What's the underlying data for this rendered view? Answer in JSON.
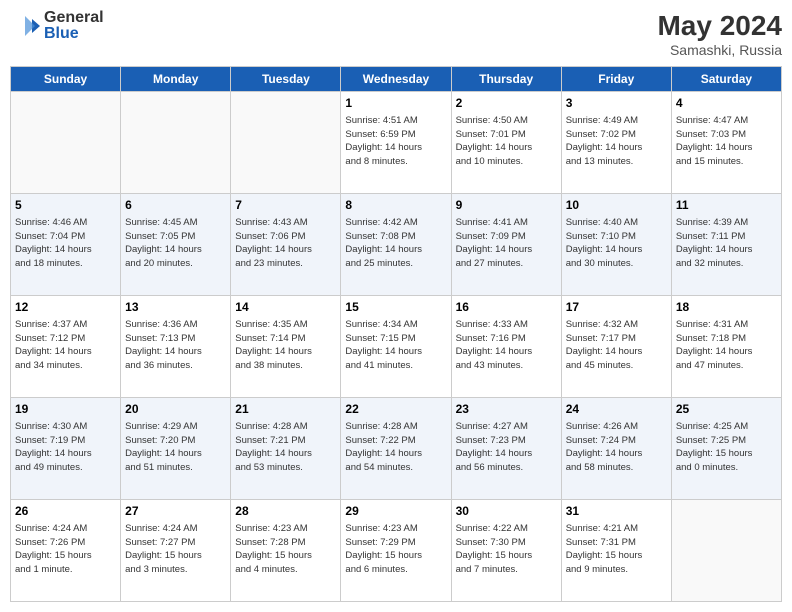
{
  "header": {
    "logo_general": "General",
    "logo_blue": "Blue",
    "month_title": "May 2024",
    "location": "Samashki, Russia"
  },
  "days_of_week": [
    "Sunday",
    "Monday",
    "Tuesday",
    "Wednesday",
    "Thursday",
    "Friday",
    "Saturday"
  ],
  "weeks": [
    [
      {
        "day": "",
        "info": ""
      },
      {
        "day": "",
        "info": ""
      },
      {
        "day": "",
        "info": ""
      },
      {
        "day": "1",
        "info": "Sunrise: 4:51 AM\nSunset: 6:59 PM\nDaylight: 14 hours\nand 8 minutes."
      },
      {
        "day": "2",
        "info": "Sunrise: 4:50 AM\nSunset: 7:01 PM\nDaylight: 14 hours\nand 10 minutes."
      },
      {
        "day": "3",
        "info": "Sunrise: 4:49 AM\nSunset: 7:02 PM\nDaylight: 14 hours\nand 13 minutes."
      },
      {
        "day": "4",
        "info": "Sunrise: 4:47 AM\nSunset: 7:03 PM\nDaylight: 14 hours\nand 15 minutes."
      }
    ],
    [
      {
        "day": "5",
        "info": "Sunrise: 4:46 AM\nSunset: 7:04 PM\nDaylight: 14 hours\nand 18 minutes."
      },
      {
        "day": "6",
        "info": "Sunrise: 4:45 AM\nSunset: 7:05 PM\nDaylight: 14 hours\nand 20 minutes."
      },
      {
        "day": "7",
        "info": "Sunrise: 4:43 AM\nSunset: 7:06 PM\nDaylight: 14 hours\nand 23 minutes."
      },
      {
        "day": "8",
        "info": "Sunrise: 4:42 AM\nSunset: 7:08 PM\nDaylight: 14 hours\nand 25 minutes."
      },
      {
        "day": "9",
        "info": "Sunrise: 4:41 AM\nSunset: 7:09 PM\nDaylight: 14 hours\nand 27 minutes."
      },
      {
        "day": "10",
        "info": "Sunrise: 4:40 AM\nSunset: 7:10 PM\nDaylight: 14 hours\nand 30 minutes."
      },
      {
        "day": "11",
        "info": "Sunrise: 4:39 AM\nSunset: 7:11 PM\nDaylight: 14 hours\nand 32 minutes."
      }
    ],
    [
      {
        "day": "12",
        "info": "Sunrise: 4:37 AM\nSunset: 7:12 PM\nDaylight: 14 hours\nand 34 minutes."
      },
      {
        "day": "13",
        "info": "Sunrise: 4:36 AM\nSunset: 7:13 PM\nDaylight: 14 hours\nand 36 minutes."
      },
      {
        "day": "14",
        "info": "Sunrise: 4:35 AM\nSunset: 7:14 PM\nDaylight: 14 hours\nand 38 minutes."
      },
      {
        "day": "15",
        "info": "Sunrise: 4:34 AM\nSunset: 7:15 PM\nDaylight: 14 hours\nand 41 minutes."
      },
      {
        "day": "16",
        "info": "Sunrise: 4:33 AM\nSunset: 7:16 PM\nDaylight: 14 hours\nand 43 minutes."
      },
      {
        "day": "17",
        "info": "Sunrise: 4:32 AM\nSunset: 7:17 PM\nDaylight: 14 hours\nand 45 minutes."
      },
      {
        "day": "18",
        "info": "Sunrise: 4:31 AM\nSunset: 7:18 PM\nDaylight: 14 hours\nand 47 minutes."
      }
    ],
    [
      {
        "day": "19",
        "info": "Sunrise: 4:30 AM\nSunset: 7:19 PM\nDaylight: 14 hours\nand 49 minutes."
      },
      {
        "day": "20",
        "info": "Sunrise: 4:29 AM\nSunset: 7:20 PM\nDaylight: 14 hours\nand 51 minutes."
      },
      {
        "day": "21",
        "info": "Sunrise: 4:28 AM\nSunset: 7:21 PM\nDaylight: 14 hours\nand 53 minutes."
      },
      {
        "day": "22",
        "info": "Sunrise: 4:28 AM\nSunset: 7:22 PM\nDaylight: 14 hours\nand 54 minutes."
      },
      {
        "day": "23",
        "info": "Sunrise: 4:27 AM\nSunset: 7:23 PM\nDaylight: 14 hours\nand 56 minutes."
      },
      {
        "day": "24",
        "info": "Sunrise: 4:26 AM\nSunset: 7:24 PM\nDaylight: 14 hours\nand 58 minutes."
      },
      {
        "day": "25",
        "info": "Sunrise: 4:25 AM\nSunset: 7:25 PM\nDaylight: 15 hours\nand 0 minutes."
      }
    ],
    [
      {
        "day": "26",
        "info": "Sunrise: 4:24 AM\nSunset: 7:26 PM\nDaylight: 15 hours\nand 1 minute."
      },
      {
        "day": "27",
        "info": "Sunrise: 4:24 AM\nSunset: 7:27 PM\nDaylight: 15 hours\nand 3 minutes."
      },
      {
        "day": "28",
        "info": "Sunrise: 4:23 AM\nSunset: 7:28 PM\nDaylight: 15 hours\nand 4 minutes."
      },
      {
        "day": "29",
        "info": "Sunrise: 4:23 AM\nSunset: 7:29 PM\nDaylight: 15 hours\nand 6 minutes."
      },
      {
        "day": "30",
        "info": "Sunrise: 4:22 AM\nSunset: 7:30 PM\nDaylight: 15 hours\nand 7 minutes."
      },
      {
        "day": "31",
        "info": "Sunrise: 4:21 AM\nSunset: 7:31 PM\nDaylight: 15 hours\nand 9 minutes."
      },
      {
        "day": "",
        "info": ""
      }
    ]
  ]
}
